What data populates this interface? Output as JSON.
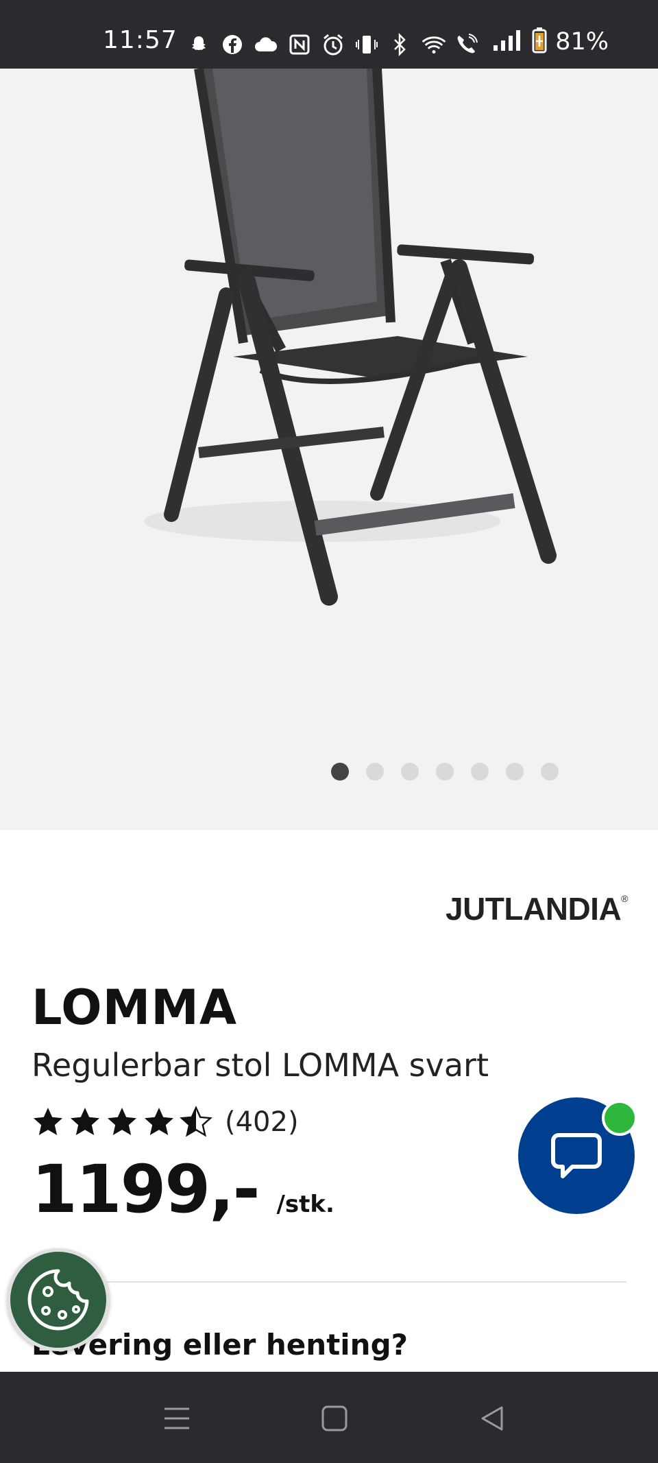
{
  "status_bar": {
    "time": "11:57",
    "battery": "81%",
    "icons": [
      "snapchat-icon",
      "facebook-icon",
      "cloud-icon",
      "nfc-icon",
      "alarm-icon",
      "vibrate-icon",
      "bluetooth-icon",
      "wifi-icon",
      "wifi-call-icon",
      "signal-icon",
      "battery-icon"
    ]
  },
  "gallery": {
    "image": "chair-product-image",
    "dot_count": 7,
    "active_index": 0
  },
  "product": {
    "brand": "JUTLANDIA",
    "brand_mark": "®",
    "title": "LOMMA",
    "subtitle": "Regulerbar stol LOMMA svart",
    "rating": 4.5,
    "rating_max": 5,
    "review_count": "(402)",
    "price": "1199,-",
    "price_unit": "/stk."
  },
  "delivery": {
    "heading": "Levering eller henting?"
  },
  "colors": {
    "chat_button": "#003e8f",
    "chat_badge": "#2db83d",
    "cookie_button": "#2f5d3f",
    "system_bars": "#2b2b2f"
  }
}
